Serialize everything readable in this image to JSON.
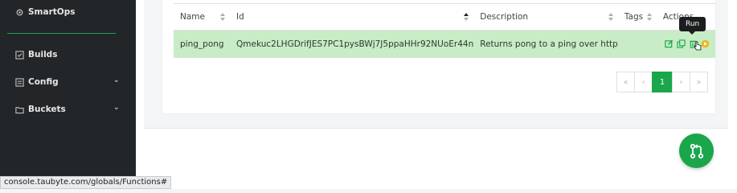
{
  "sidebar": {
    "items": [
      {
        "label": "SmartOps",
        "icon": "gear-icon"
      },
      {
        "label": "Builds",
        "icon": "checkbox-icon"
      },
      {
        "label": "Config",
        "icon": "list-icon"
      },
      {
        "label": "Buckets",
        "icon": "folder-icon"
      }
    ]
  },
  "table": {
    "headers": [
      "Name",
      "Id",
      "Description",
      "Tags",
      "Actions"
    ],
    "rows": [
      {
        "name": "ping_pong",
        "id": "Qmekuc2LHGDrifJES7PC1pysBWj7J5ppaHHr92NUoEr44n",
        "description": "Returns pong to a ping over http"
      }
    ]
  },
  "tooltip": "Run",
  "pagination": {
    "first": "«",
    "prev": "‹",
    "current": "1",
    "next": "›",
    "last": "»"
  },
  "status_url": "console.taubyte.com/globals/Functions#",
  "colors": {
    "accent": "#1aa64b",
    "row_highlight": "#c8ecc6",
    "sidebar": "#222629"
  }
}
